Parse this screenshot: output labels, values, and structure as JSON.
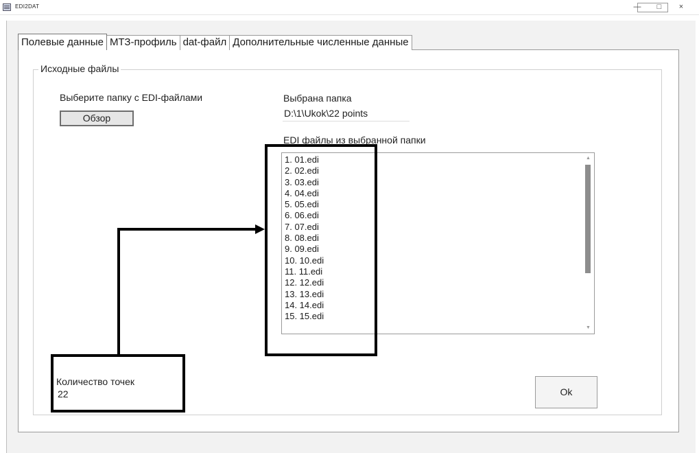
{
  "window": {
    "title": "EDI2DAT",
    "controls": {
      "minimize": "—",
      "maximize": "□",
      "close": "×"
    }
  },
  "tabs": [
    {
      "label": "Полевые данные",
      "active": true
    },
    {
      "label": "МТЗ-профиль",
      "active": false
    },
    {
      "label": "dat-файл",
      "active": false
    },
    {
      "label": "Дополнительные численные данные",
      "active": false
    }
  ],
  "group": {
    "legend": "Исходные файлы"
  },
  "source": {
    "select_folder_label": "Выберите папку с EDI-файлами",
    "browse_label": "Обзор"
  },
  "selected": {
    "folder_label": "Выбрана папка",
    "folder_path": "D:\\1\\Ukok\\22 points"
  },
  "edi_list": {
    "label": "EDI файлы из выбранной папки",
    "items": [
      "1. 01.edi",
      "2. 02.edi",
      "3. 03.edi",
      "4. 04.edi",
      "5. 05.edi",
      "6. 06.edi",
      "7. 07.edi",
      "8. 08.edi",
      "9. 09.edi",
      "10. 10.edi",
      "11. 11.edi",
      "12. 12.edi",
      "13. 13.edi",
      "14. 14.edi",
      "15. 15.edi"
    ]
  },
  "points": {
    "label": "Количество точек",
    "value": "22"
  },
  "ok_label": "Ok"
}
